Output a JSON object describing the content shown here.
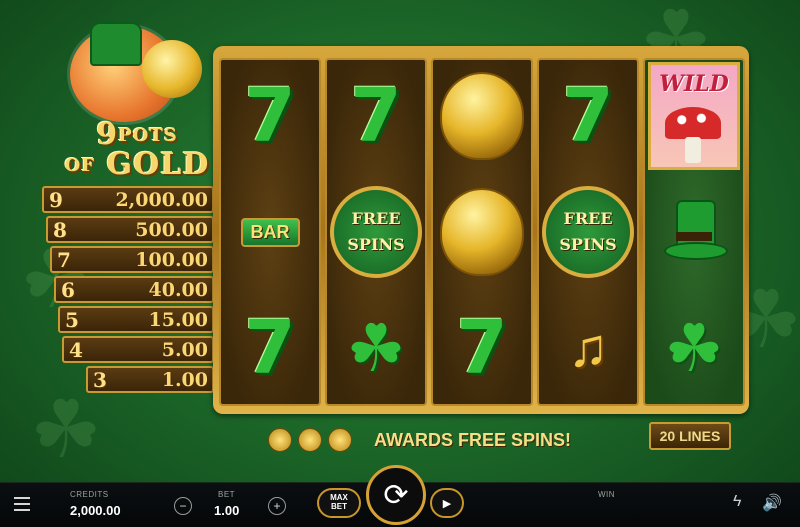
{
  "logo": {
    "title_number": "9",
    "title_line1": "POTS",
    "title_of": "OF",
    "title_line2": "GOLD"
  },
  "paytable": [
    {
      "pots": "9",
      "amount": "2,000.00"
    },
    {
      "pots": "8",
      "amount": "500.00"
    },
    {
      "pots": "7",
      "amount": "100.00"
    },
    {
      "pots": "6",
      "amount": "40.00"
    },
    {
      "pots": "5",
      "amount": "15.00"
    },
    {
      "pots": "4",
      "amount": "5.00"
    },
    {
      "pots": "3",
      "amount": "1.00"
    }
  ],
  "reels": {
    "bar_label": "BAR",
    "free_spins_line1": "FREE",
    "free_spins_line2": "SPINS",
    "wild_label": "WILD",
    "seven_glyph": "7",
    "icons": {
      "clover": "clover-icon",
      "harp": "harp-icon",
      "hat": "leprechaun-hat-icon",
      "pot": "pot-of-gold-icon",
      "wild": "mushroom-wild-icon"
    }
  },
  "feature": {
    "awards_text": "AWARDS FREE SPINS!",
    "lines_label": "20 LINES"
  },
  "bottombar": {
    "credits_label": "CREDITS",
    "credits_value": "2,000.00",
    "bet_label": "BET",
    "bet_value": "1.00",
    "minus": "−",
    "plus": "+",
    "maxbet_line1": "MAX",
    "maxbet_line2": "BET",
    "win_label": "WIN",
    "spin_glyph": "⟳",
    "autoplay_glyph": "▶",
    "turbo_glyph": "ϟ",
    "sound_glyph": "🔊"
  },
  "colors": {
    "background": "#1d6a2a",
    "frame_gold": "#d6a73c",
    "accent_gold": "#f6d86a",
    "seven_green": "#2fbf3a"
  }
}
